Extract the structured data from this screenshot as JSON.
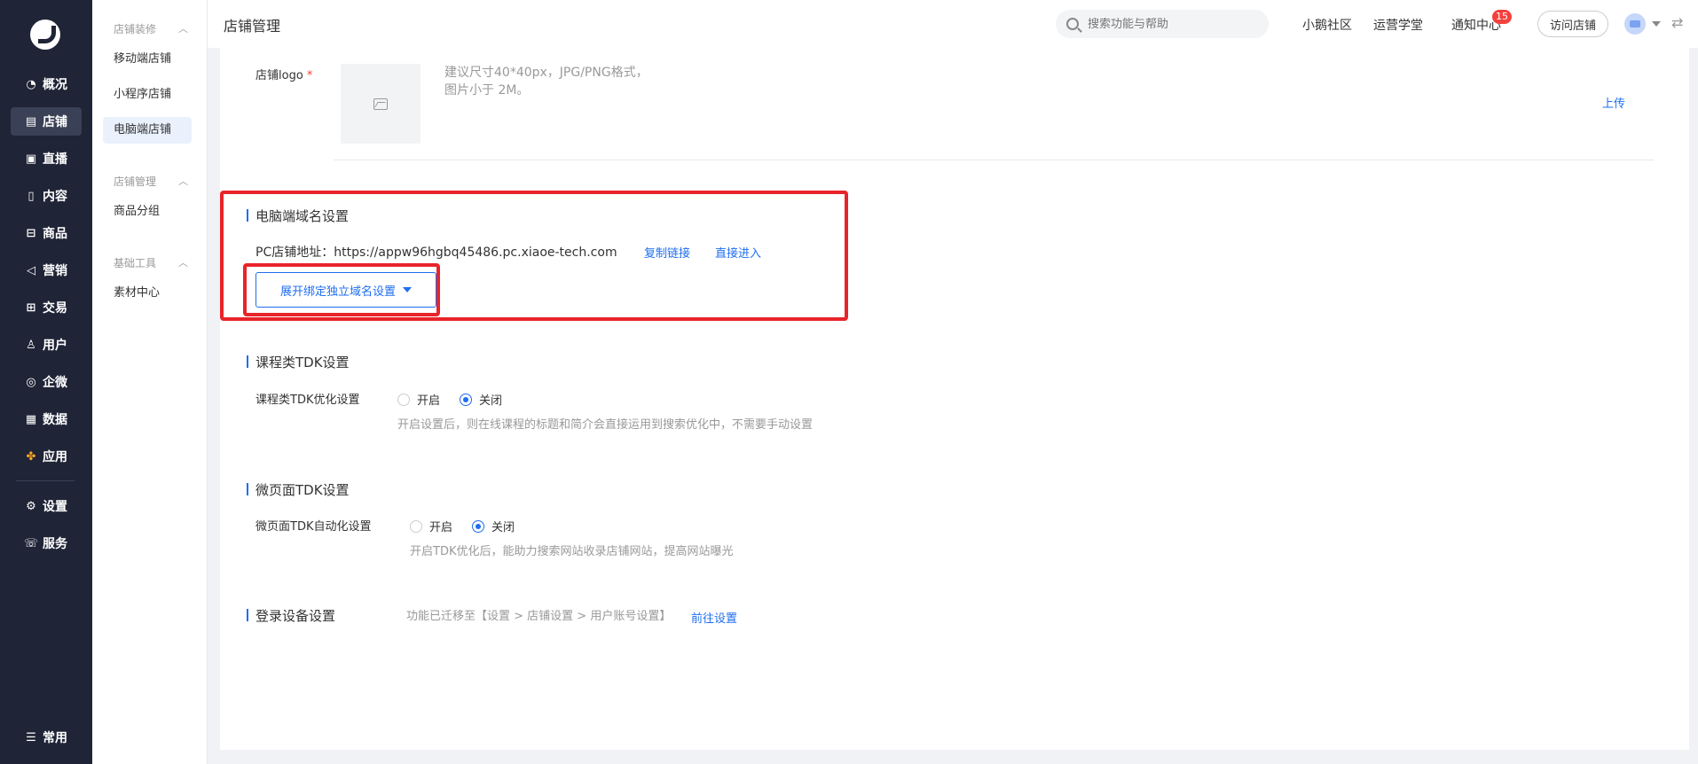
{
  "nav": {
    "items": [
      {
        "label": "概况",
        "icon": "dashboard-icon"
      },
      {
        "label": "店铺",
        "icon": "store-icon"
      },
      {
        "label": "直播",
        "icon": "live-icon"
      },
      {
        "label": "内容",
        "icon": "content-icon"
      },
      {
        "label": "商品",
        "icon": "goods-icon"
      },
      {
        "label": "营销",
        "icon": "marketing-icon"
      },
      {
        "label": "交易",
        "icon": "trade-icon"
      },
      {
        "label": "用户",
        "icon": "user-icon"
      },
      {
        "label": "企微",
        "icon": "wecom-icon"
      },
      {
        "label": "数据",
        "icon": "data-icon"
      },
      {
        "label": "应用",
        "icon": "apps-icon"
      },
      {
        "label": "设置",
        "icon": "settings-icon"
      },
      {
        "label": "服务",
        "icon": "service-icon"
      },
      {
        "label": "常用",
        "icon": "frequent-icon"
      }
    ]
  },
  "subnav": {
    "group1": "店铺装修",
    "group1_items": [
      "移动端店铺",
      "小程序店铺",
      "电脑端店铺"
    ],
    "group2": "店铺管理",
    "group2_items": [
      "商品分组"
    ],
    "group3": "基础工具",
    "group3_items": [
      "素材中心"
    ]
  },
  "topbar": {
    "title": "店铺管理",
    "search_placeholder": "搜索功能与帮助",
    "community": "小鹅社区",
    "academy": "运营学堂",
    "notify": "通知中心",
    "notify_count": "15",
    "visit_store": "访问店铺"
  },
  "logo_section": {
    "label": "店铺logo",
    "required": "*",
    "hint_line1": "建议尺寸40*40px，JPG/PNG格式，",
    "hint_line2": "图片小于 2M。",
    "upload": "上传"
  },
  "domain_section": {
    "title": "电脑端域名设置",
    "address": "PC店铺地址：https://appw96hgbq45486.pc.xiaoe-tech.com",
    "copy_link": "复制链接",
    "enter": "直接进入",
    "expand_button": "展开绑定独立域名设置"
  },
  "course_tdk": {
    "title": "课程类TDK设置",
    "label": "课程类TDK优化设置",
    "on": "开启",
    "off": "关闭",
    "selected": "off",
    "hint": "开启设置后，则在线课程的标题和简介会直接运用到搜索优化中，不需要手动设置"
  },
  "micro_tdk": {
    "title": "微页面TDK设置",
    "label": "微页面TDK自动化设置",
    "on": "开启",
    "off": "关闭",
    "selected": "off",
    "hint": "开启TDK优化后，能助力搜索网站收录店铺网站，提高网站曝光"
  },
  "login_device": {
    "title": "登录设备设置",
    "moved_text": "功能已迁移至【设置 > 店铺设置 > 用户账号设置】",
    "goto": "前往设置"
  }
}
